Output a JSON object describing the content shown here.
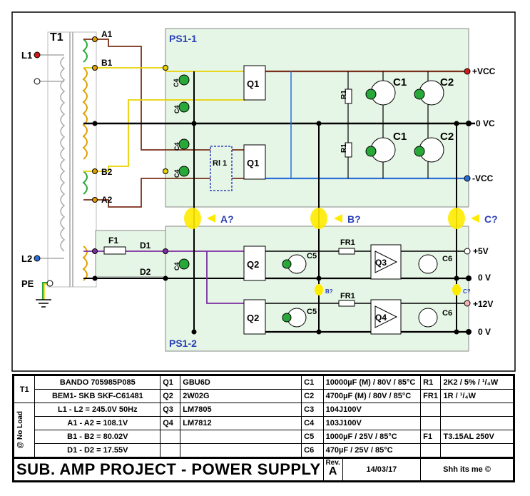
{
  "schematic": {
    "transformer": {
      "ref": "T1",
      "terminals": {
        "L1": "L1",
        "L2": "L2",
        "PE": "PE",
        "A1": "A1",
        "B1": "B1",
        "B2": "B2",
        "A2": "A2",
        "D1": "D1",
        "D2": "D2"
      }
    },
    "fuse_ref": "F1",
    "blocks": {
      "top": "PS1-1",
      "bottom": "PS1-2"
    },
    "relay": "Rl 1",
    "components": {
      "Q1": "Q1",
      "Q2": "Q2",
      "Q3": "Q3",
      "Q4": "Q4",
      "C1": "C1",
      "C2": "C2",
      "C3": "C3",
      "C4": "C4",
      "C5": "C5",
      "C6": "C6",
      "R1": "R1",
      "FR1": "FR1"
    },
    "rails": {
      "vcc_pos": "+VCC",
      "zero_vc": "0 VC",
      "vcc_neg": "-VCC",
      "v5": "+5V",
      "v0a": "0 V",
      "v12": "+12V",
      "v0b": "0 V"
    },
    "points": {
      "A": "A?",
      "B": "B?",
      "C": "C?",
      "B_small": "B?",
      "C_small": "C?"
    },
    "colors": {
      "block_fill": "#e6f6e6",
      "wire_brown": "#7a2f1a",
      "wire_yellow": "#e8d200",
      "wire_blue": "#2a6fd8",
      "wire_purple": "#7a2ea0",
      "coil_green": "#29a83a",
      "coil_orange": "#e0a000",
      "accent_blue": "#2a3fb5",
      "red_dot": "#d21a1a"
    }
  },
  "bom": {
    "T1": {
      "ref": "T1",
      "line1": "BANDO   705985P085",
      "line2": "BEM1- SKB   SKF-C61481"
    },
    "no_load_label": "@ No Load",
    "no_load": [
      "L1 - L2 = 245.0V  50Hz",
      "A1 - A2 = 108.1V",
      "B1 - B2 = 80.02V",
      "D1 - D2 = 17.55V"
    ],
    "q": [
      {
        "ref": "Q1",
        "val": "GBU6D"
      },
      {
        "ref": "Q2",
        "val": "2W02G"
      },
      {
        "ref": "Q3",
        "val": "LM7805"
      },
      {
        "ref": "Q4",
        "val": "LM7812"
      }
    ],
    "c": [
      {
        "ref": "C1",
        "val": "10000µF (M) / 80V / 85°C"
      },
      {
        "ref": "C2",
        "val": "4700µF (M) / 80V / 85°C"
      },
      {
        "ref": "C3",
        "val": "104J100V"
      },
      {
        "ref": "C4",
        "val": "103J100V"
      },
      {
        "ref": "C5",
        "val": "1000µF / 25V / 85°C"
      },
      {
        "ref": "C6",
        "val": "470µF / 25V / 85°C"
      }
    ],
    "r": [
      {
        "ref": "R1",
        "val": "2K2 / 5% / ¹/₄W"
      },
      {
        "ref": "FR1",
        "val": "1R  / ¹/₄W"
      },
      {
        "ref": "F1",
        "val": "T3.15AL  250V"
      }
    ],
    "title": "SUB. AMP PROJECT - POWER SUPPLY",
    "rev_label": "Rev.",
    "rev": "A",
    "date": "14/03/17",
    "author": "Shh its me  ©"
  }
}
